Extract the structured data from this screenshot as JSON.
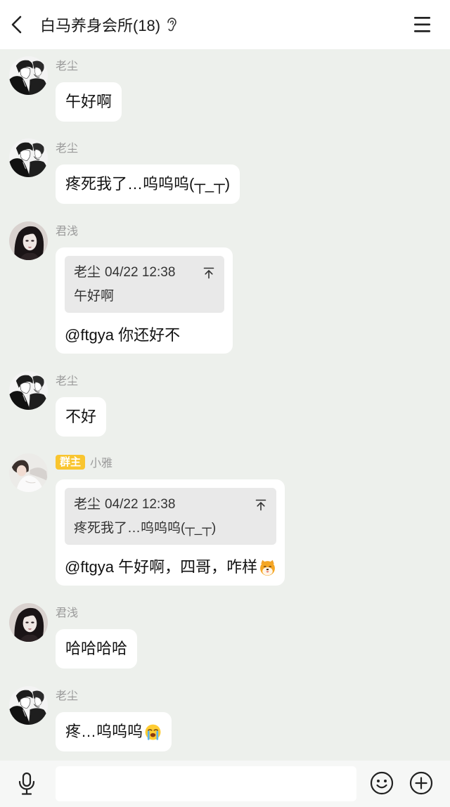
{
  "header": {
    "title": "白马养身会所(18)"
  },
  "messages": [
    {
      "sender": "老尘",
      "text": "午好啊"
    },
    {
      "sender": "老尘",
      "text": "疼死我了…呜呜呜(┬_┬)"
    },
    {
      "sender": "君浅",
      "quote": {
        "author": "老尘",
        "time": "04/22 12:38",
        "text": "午好啊"
      },
      "text": "@ftgya 你还好不"
    },
    {
      "sender": "老尘",
      "text": "不好"
    },
    {
      "sender": "小雅",
      "badge": "群主",
      "quote": {
        "author": "老尘",
        "time": "04/22 12:38",
        "text": "疼死我了…呜呜呜(┬_┬)"
      },
      "text": "@ftgya 午好啊，四哥，咋样",
      "emoji": "shiba-dog-emoji"
    },
    {
      "sender": "君浅",
      "text": "哈哈哈哈"
    },
    {
      "sender": "老尘",
      "text": "疼…呜呜呜",
      "emoji": "loudly-crying-emoji"
    }
  ],
  "input_bar": {
    "value": ""
  },
  "icons": {
    "back": "back-arrow-icon",
    "earpiece_mode": "ear-icon",
    "menu": "hamburger-menu-icon",
    "quote_jump": "jump-to-original-icon",
    "voice": "microphone-icon",
    "emoji": "smiley-icon",
    "more": "plus-circle-icon"
  },
  "colors": {
    "chat_background": "#edf0ec",
    "header_background": "#ffffff",
    "bubble": "#ffffff",
    "quote_background": "#e9e9e9",
    "sender_name": "#9a9a9a",
    "owner_badge": "#f9c52f",
    "bottom_bar": "#f6f7f6"
  }
}
